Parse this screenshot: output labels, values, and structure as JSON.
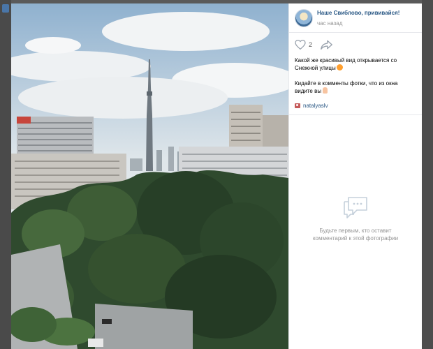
{
  "post": {
    "group_name": "Наше Свиблово, прививайся!",
    "time": "час назад",
    "likes": "2",
    "caption_line1": "Какой же красивый вид открывается со Снежной улицы",
    "caption_line2": "Кидайте в комменты фотки, что из окна видите вы",
    "author": "natalyaslv"
  },
  "comments": {
    "empty_text": "Будьте первым, кто оставит комментарий к этой фотографии"
  },
  "colors": {
    "link": "#2a5885",
    "muted": "#939393",
    "accent": "#4a76a8"
  },
  "icons": [
    "heart-icon",
    "share-icon",
    "camera-icon",
    "comment-icon"
  ]
}
